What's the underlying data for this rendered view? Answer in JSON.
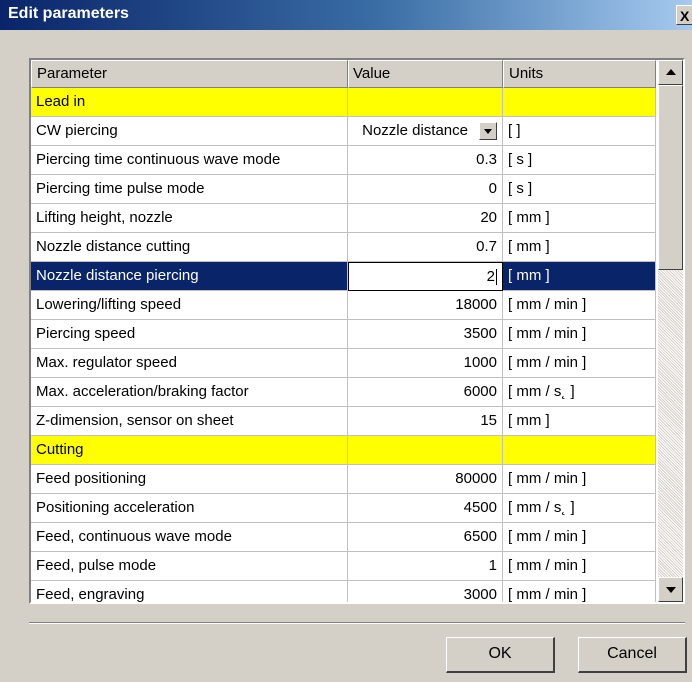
{
  "window": {
    "title": "Edit parameters",
    "close_label": "X"
  },
  "grid": {
    "columns": [
      "Parameter",
      "Value",
      "Units"
    ],
    "rows": [
      {
        "parameter": "Lead in",
        "value": "",
        "units": "",
        "kind": "section"
      },
      {
        "parameter": "CW piercing",
        "value": "Nozzle distance",
        "units": "[ ]",
        "kind": "dropdown"
      },
      {
        "parameter": "Piercing time continuous wave mode",
        "value": "0.3",
        "units": "[ s ]"
      },
      {
        "parameter": "Piercing time pulse mode",
        "value": "0",
        "units": "[ s ]"
      },
      {
        "parameter": "Lifting height, nozzle",
        "value": "20",
        "units": "[ mm ]"
      },
      {
        "parameter": "Nozzle distance cutting",
        "value": "0.7",
        "units": "[ mm ]"
      },
      {
        "parameter": "Nozzle distance piercing",
        "value": "2",
        "units": "[ mm ]",
        "kind": "selected"
      },
      {
        "parameter": "Lowering/lifting speed",
        "value": "18000",
        "units": "[ mm / min ]"
      },
      {
        "parameter": "Piercing speed",
        "value": "3500",
        "units": "[ mm / min ]"
      },
      {
        "parameter": "Max. regulator speed",
        "value": "1000",
        "units": "[ mm / min ]"
      },
      {
        "parameter": "Max. acceleration/braking factor",
        "value": "6000",
        "units": "[ mm / s˛ ]"
      },
      {
        "parameter": "Z-dimension, sensor on sheet",
        "value": "15",
        "units": "[ mm ]"
      },
      {
        "parameter": "Cutting",
        "value": "",
        "units": "",
        "kind": "section"
      },
      {
        "parameter": "Feed positioning",
        "value": "80000",
        "units": "[ mm / min ]"
      },
      {
        "parameter": "Positioning acceleration",
        "value": "4500",
        "units": "[ mm / s˛ ]"
      },
      {
        "parameter": "Feed, continuous wave mode",
        "value": "6500",
        "units": "[ mm / min ]"
      },
      {
        "parameter": "Feed, pulse mode",
        "value": "1",
        "units": "[ mm / min ]"
      },
      {
        "parameter": "Feed, engraving",
        "value": "3000",
        "units": "[ mm / min ]"
      }
    ]
  },
  "buttons": {
    "ok_label": "OK",
    "cancel_label": "Cancel"
  },
  "colors": {
    "section_highlight": "#ffff00",
    "selection": "#0a246a",
    "titlebar": "#0a246a"
  }
}
